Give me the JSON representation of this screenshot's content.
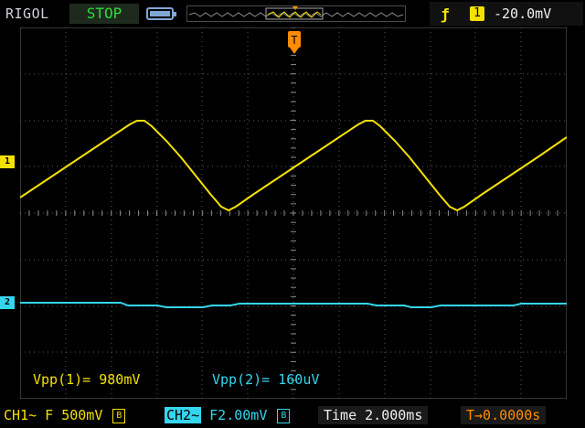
{
  "header": {
    "brand": "RIGOL",
    "run_state": "STOP",
    "run_state_color": "#2bdc3c",
    "trigger": {
      "edge_icon": "rising-edge-icon",
      "source": "1",
      "level": "-20.0mV"
    }
  },
  "markers": {
    "trigger_position_label": "T",
    "ch1_marker": "1",
    "ch2_marker": "2"
  },
  "measurements": {
    "vpp1": "Vpp(1)= 980mV",
    "vpp2": "Vpp(2)= 160uV"
  },
  "footer": {
    "ch1_label": "CH1~ F 500mV",
    "ch1_bw": "B",
    "ch2_tag": "CH2~",
    "ch2_rest": "F2.00mV",
    "ch2_bw": "B",
    "timebase": "Time 2.000ms",
    "trigger_offset": "T→0.0000s"
  },
  "colors": {
    "ch1": "#f5e100",
    "ch2": "#34d6ee",
    "trigger": "#ff8c00",
    "grid": "#5a5a5a"
  }
}
